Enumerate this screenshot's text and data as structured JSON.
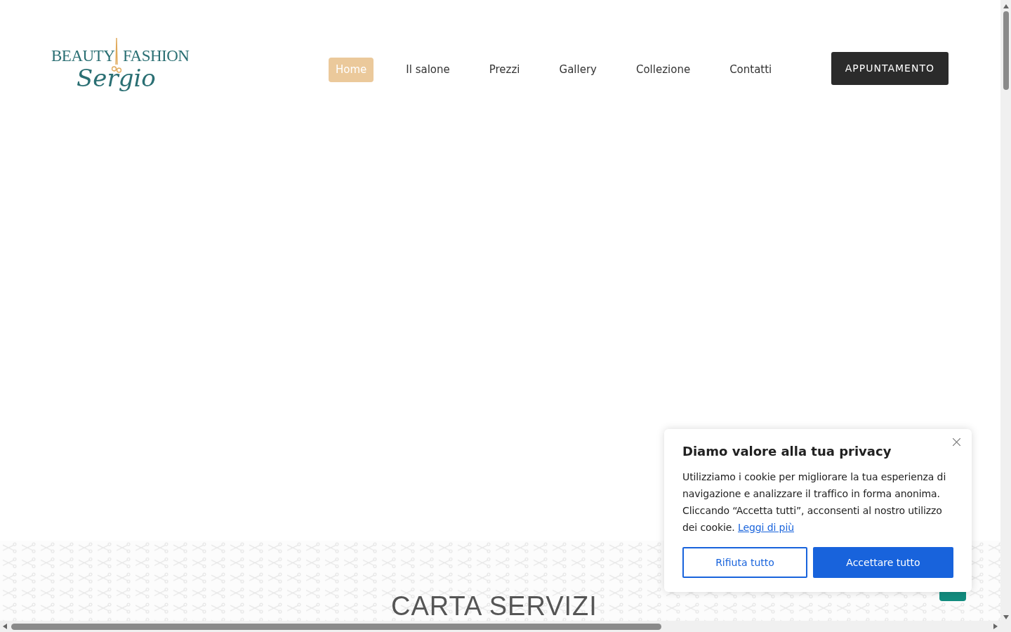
{
  "logo": {
    "left_word": "BEAUTY",
    "right_word": "FASHION",
    "script_word": "Sergio"
  },
  "nav": {
    "items": [
      {
        "label": "Home",
        "selected": true
      },
      {
        "label": "Il salone",
        "selected": false
      },
      {
        "label": "Prezzi",
        "selected": false
      },
      {
        "label": "Gallery",
        "selected": false
      },
      {
        "label": "Collezione",
        "selected": false
      },
      {
        "label": "Contatti",
        "selected": false
      }
    ],
    "cta": "APPUNTAMENTO"
  },
  "section_heading": "CARTA SERVIZI",
  "cookie_banner": {
    "title": "Diamo valore alla tua privacy",
    "text": "Utilizziamo i cookie per migliorare la tua esperienza di navigazione e analizzare il traffico in forma anonima. Cliccando “Accetta tutti”, acconsenti al nostro utilizzo dei cookie.",
    "link": "Leggi di più",
    "buttons": [
      {
        "label": "Rifiuta tutto",
        "kind": "outline"
      },
      {
        "label": "Accettare tutto",
        "kind": "filled"
      }
    ]
  }
}
